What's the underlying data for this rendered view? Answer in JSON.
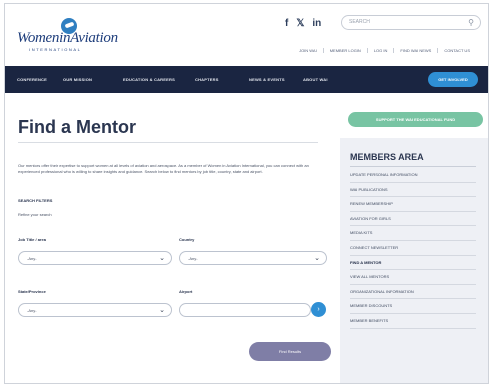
{
  "header": {
    "logo_text": "WomeninAviation",
    "logo_sub": "INTERNATIONAL",
    "search_placeholder": "SEARCH",
    "social": [
      "f",
      "𝕏",
      "in"
    ],
    "top_links": [
      "JOIN WAI",
      "MEMBER LOGIN",
      "LOG IN",
      "FIND WAI NEWS",
      "CONTACT US"
    ]
  },
  "nav": {
    "items": [
      "CONFERENCE",
      "OUR MISSION",
      "EDUCATION & CAREERS",
      "CHAPTERS",
      "NEWS & EVENTS",
      "ABOUT WAI"
    ],
    "cta": "GET INVOLVED"
  },
  "main": {
    "title": "Find a Mentor",
    "intro": "Our mentors offer their expertise to support women at all levels of aviation and aerospace. As a member of Women in Aviation International, you can connect with an experienced professional who is willing to share insights and guidance. Search below to find mentors by job title, country, state and airport.",
    "search_filters_label": "SEARCH FILTERS",
    "refine_label": "Refine your search",
    "fields": {
      "job_title": {
        "label": "Job Title / area",
        "value": "-Any-"
      },
      "country": {
        "label": "Country",
        "value": "-Any-"
      },
      "state": {
        "label": "State/Province",
        "value": "-Any-"
      },
      "airport": {
        "label": "Airport",
        "value": ""
      }
    },
    "find_button": "Find Results"
  },
  "sidebar": {
    "cta": "SUPPORT THE WAI EDUCATIONAL FUND",
    "title": "MEMBERS AREA",
    "items": [
      "UPDATE PERSONAL INFORMATION",
      "WAI PUBLICATIONS",
      "RENEW MEMBERSHIP",
      "AVIATION FOR GIRLS",
      "MEDIA KITS",
      "CONNECT NEWSLETTER",
      "FIND A MENTOR",
      "VIEW ALL MENTORS",
      "ORGANIZATIONAL INFORMATION",
      "MEMBER DISCOUNTS",
      "MEMBER BENEFITS"
    ],
    "active_index": 6
  },
  "colors": {
    "nav_bg": "#1a2541",
    "accent_blue": "#2f8fd4",
    "accent_green": "#78c4a3",
    "button_purple": "#7f7ea6",
    "sidebar_bg": "#eef0f5"
  }
}
